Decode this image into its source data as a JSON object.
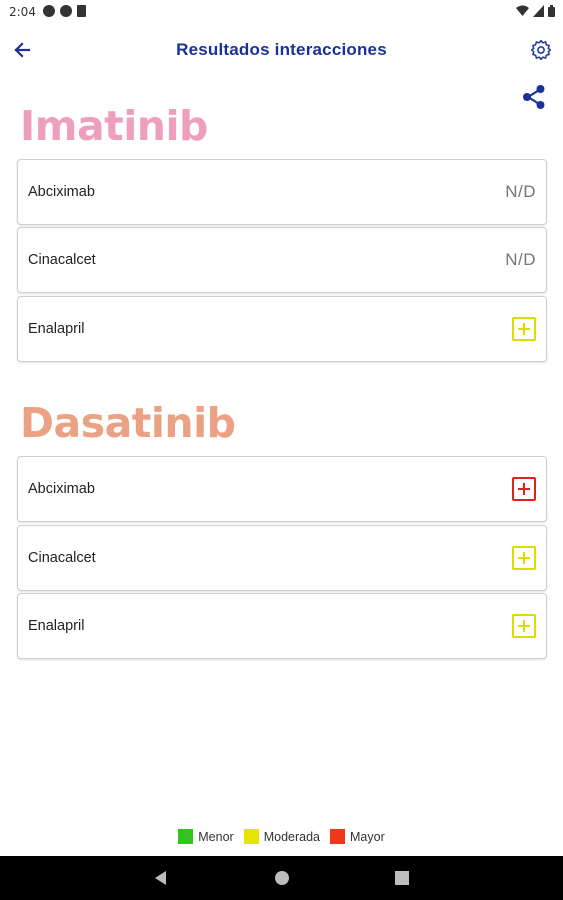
{
  "status_bar": {
    "time": "2:04",
    "left_icons": [
      "a-icon",
      "g-icon",
      "sd-card-icon"
    ],
    "right_icons": [
      "wifi-icon",
      "signal-icon",
      "battery-icon"
    ]
  },
  "app_bar": {
    "title": "Resultados interacciones",
    "back_icon": "arrow-back-icon",
    "settings_icon": "gear-icon"
  },
  "share_icon": "share-icon",
  "sections": [
    {
      "drug": "Imatinib",
      "color": "#ee9fbd",
      "items": [
        {
          "label": "Abciximab",
          "result": "N/D"
        },
        {
          "label": "Cinacalcet",
          "result": "N/D"
        },
        {
          "label": "Enalapril",
          "result": "moderate",
          "icon": "plus-box-icon",
          "color": "#dcdc00"
        }
      ]
    },
    {
      "drug": "Dasatinib",
      "color": "#eba183",
      "items": [
        {
          "label": "Abciximab",
          "result": "major",
          "icon": "plus-box-icon",
          "color": "#e0231a"
        },
        {
          "label": "Cinacalcet",
          "result": "moderate",
          "icon": "plus-box-icon",
          "color": "#dcdc00"
        },
        {
          "label": "Enalapril",
          "result": "moderate",
          "icon": "plus-box-icon",
          "color": "#dcdc00"
        }
      ]
    }
  ],
  "legend": [
    {
      "label": "Menor",
      "color": "#36c21e"
    },
    {
      "label": "Moderada",
      "color": "#e6e600"
    },
    {
      "label": "Mayor",
      "color": "#f0371a"
    }
  ],
  "nav_bar": [
    "nav-back-icon",
    "nav-home-icon",
    "nav-recent-icon"
  ]
}
